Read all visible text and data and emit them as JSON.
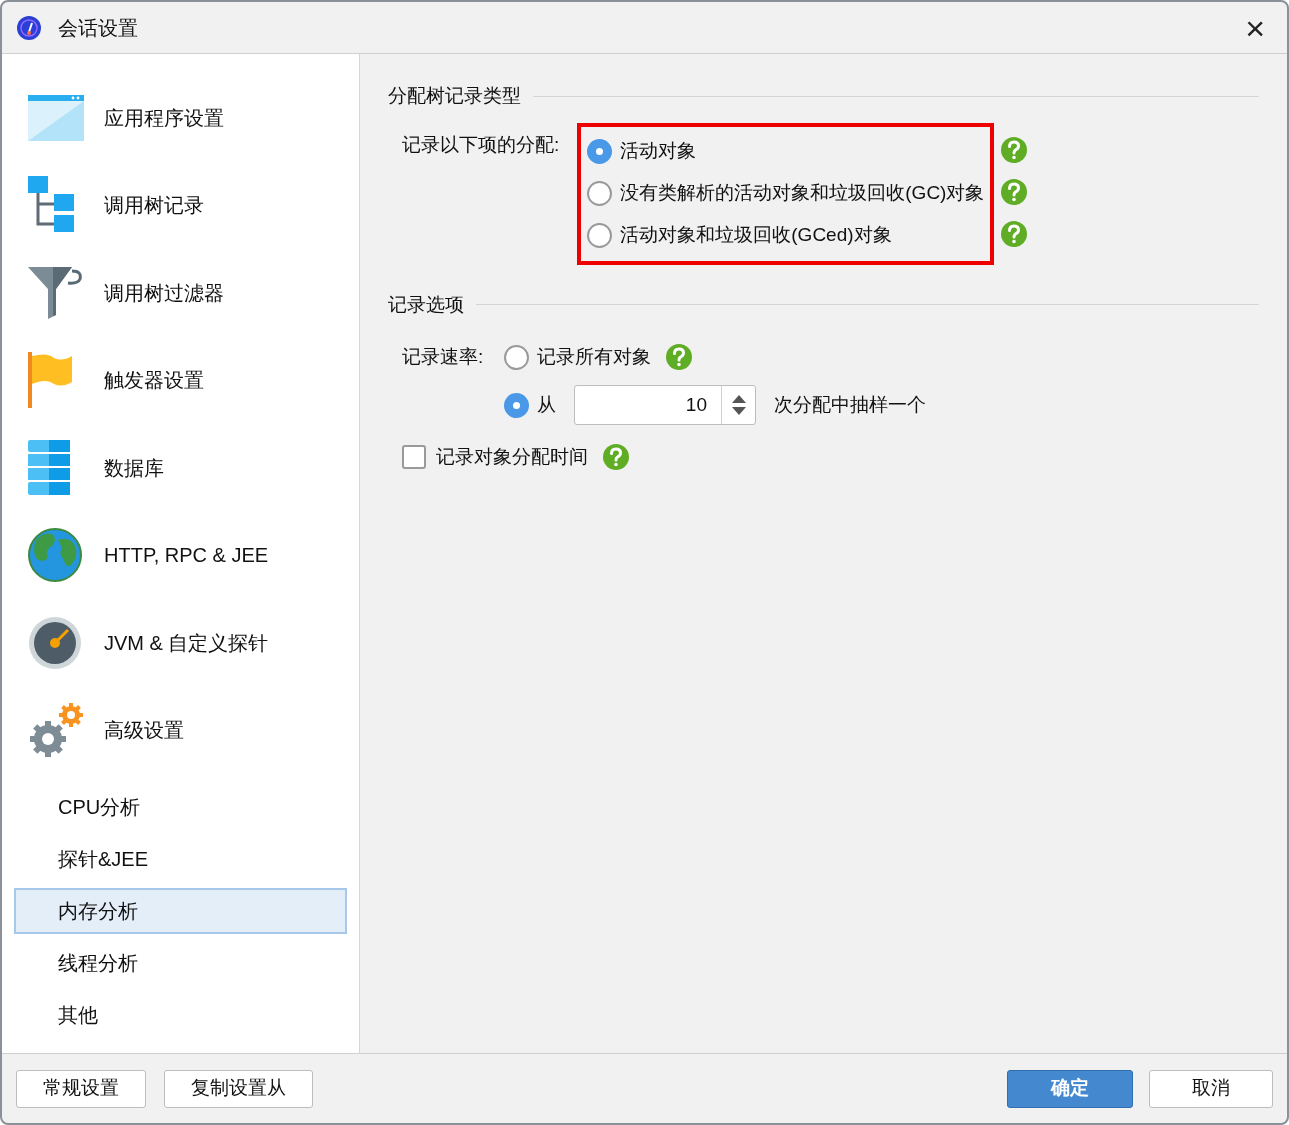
{
  "window": {
    "title": "会话设置",
    "close": "×"
  },
  "sidebar": {
    "items": [
      {
        "kind": "section",
        "label": "应用程序设置"
      },
      {
        "kind": "section",
        "label": "调用树记录"
      },
      {
        "kind": "section",
        "label": "调用树过滤器"
      },
      {
        "kind": "section",
        "label": "触发器设置"
      },
      {
        "kind": "section",
        "label": "数据库"
      },
      {
        "kind": "section",
        "label": "HTTP, RPC & JEE"
      },
      {
        "kind": "section",
        "label": "JVM & 自定义探针"
      },
      {
        "kind": "section",
        "label": "高级设置"
      },
      {
        "kind": "page",
        "label": "CPU分析",
        "selected": false
      },
      {
        "kind": "page",
        "label": "探针&JEE",
        "selected": false
      },
      {
        "kind": "page",
        "label": "内存分析",
        "selected": true
      },
      {
        "kind": "page",
        "label": "线程分析",
        "selected": false
      },
      {
        "kind": "page",
        "label": "其他",
        "selected": false
      }
    ]
  },
  "allocation_group": {
    "title": "分配树记录类型",
    "label": "记录以下项的分配:",
    "highlighted": true,
    "options": [
      {
        "label": "活动对象",
        "selected": true
      },
      {
        "label": "没有类解析的活动对象和垃圾回收(GC)对象",
        "selected": false
      },
      {
        "label": "活动对象和垃圾回收(GCed)对象",
        "selected": false
      }
    ]
  },
  "recording_group": {
    "title": "记录选项",
    "rate_label": "记录速率:",
    "rate_options": [
      {
        "kind": "plain",
        "label": "记录所有对象",
        "selected": false
      },
      {
        "kind": "sampling",
        "label": "从",
        "selected": true,
        "value": "10",
        "suffix": "次分配中抽样一个"
      }
    ],
    "time_checkbox": {
      "label": "记录对象分配时间",
      "checked": false
    }
  },
  "footer": {
    "left_buttons": [
      "常规设置",
      "复制设置从"
    ],
    "ok": "确定",
    "cancel": "取消"
  }
}
